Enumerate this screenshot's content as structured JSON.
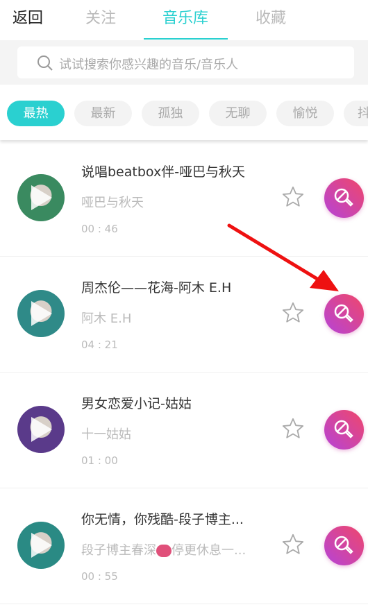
{
  "header": {
    "back_label": "返回",
    "tabs": [
      {
        "label": "关注"
      },
      {
        "label": "音乐库",
        "active": true
      },
      {
        "label": "收藏"
      }
    ]
  },
  "search": {
    "placeholder": "试试搜索你感兴趣的音乐/音乐人"
  },
  "chips": [
    {
      "label": "最热",
      "active": true
    },
    {
      "label": "最新"
    },
    {
      "label": "孤独"
    },
    {
      "label": "无聊"
    },
    {
      "label": "愉悦"
    },
    {
      "label": "抖"
    }
  ],
  "songs": [
    {
      "title": "说唱beatbox伴-哑巴与秋天",
      "artist": "哑巴与秋天",
      "duration": "00 : 46",
      "avatar_color": "#3a8a60"
    },
    {
      "title": "周杰伦——花海-阿木  E.H",
      "artist": "阿木    E.H",
      "duration": "04 : 21",
      "avatar_color": "#2f8a88"
    },
    {
      "title": "男女恋爱小记-姑姑",
      "artist": "十一姑姑",
      "duration": "01 : 00",
      "avatar_color": "#5a3a8a"
    },
    {
      "title": "你无情，你残酷-段子博主...",
      "artist": "段子博主春深",
      "artist_suffix": "停更休息一...",
      "duration": "00 : 55",
      "avatar_color": "#2a8a84"
    }
  ],
  "colors": {
    "accent": "#2ad0d0",
    "mic_gradient_start": "#f0466a",
    "mic_gradient_end": "#b544d8",
    "annotation_arrow": "#ee1111"
  }
}
